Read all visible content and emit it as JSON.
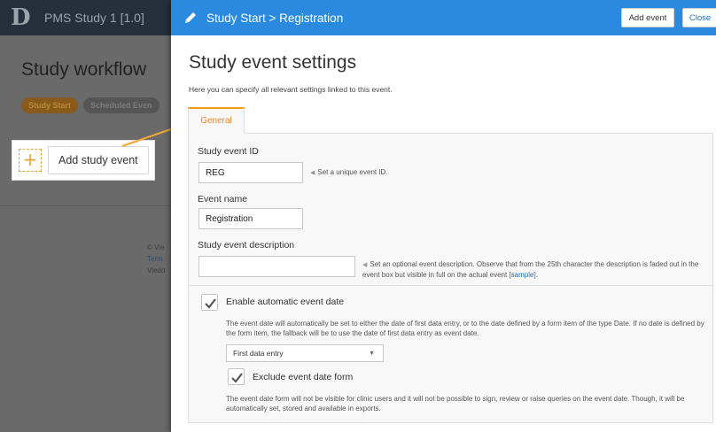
{
  "background": {
    "app_name": "PMS Study 1 [1.0]",
    "logo": "D",
    "page_title": "Study workflow",
    "tabs": [
      "Study Start",
      "Scheduled Even"
    ],
    "add_button": "Add study event",
    "plus_icon": "+",
    "footer": {
      "line1": "© Vie",
      "line2": "Term",
      "line3": "Viedo"
    }
  },
  "modal": {
    "header": {
      "title": "Study Start > Registration",
      "add_event": "Add event",
      "close": "Close"
    },
    "title": "Study event settings",
    "subtitle": "Here you can specify all relevant settings linked to this event.",
    "tab": "General",
    "fields": {
      "event_id": {
        "label": "Study event ID",
        "value": "REG",
        "hint": "Set a unique event ID."
      },
      "event_name": {
        "label": "Event name",
        "value": "Registration"
      },
      "description": {
        "label": "Study event description",
        "value": "",
        "hint": "Set an optional event description. Observe that from the 25th character the description is faded out in the event box but visible in full on the actual event",
        "hint_link": "[sample]",
        "hint_end": "."
      }
    },
    "auto_date": {
      "label": "Enable automatic event date",
      "checked": true,
      "description": "The event date will automatically be set to either the date of first data entry, or to the date defined by a form item of the type Date. If no date is defined by the form item, the fallback will be to use the date of first data entry as event date.",
      "select_value": "First data entry"
    },
    "exclude_form": {
      "label": "Exclude event date form",
      "checked": true,
      "description": "The event date form will not be visible for clinic users and it will not be possible to sign, review or raise queries on the event date. Though, it will be automatically set, stored and available in exports."
    }
  },
  "colors": {
    "header_blue": "#2a8ae0",
    "accent_orange": "#f39c12"
  }
}
